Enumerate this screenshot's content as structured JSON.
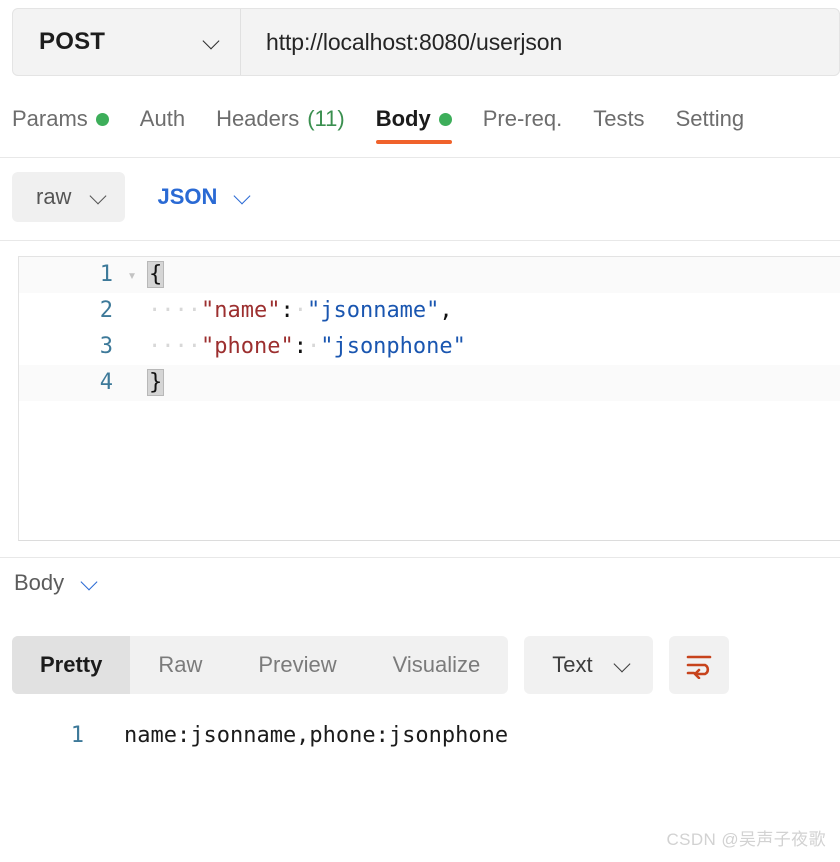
{
  "request": {
    "method": "POST",
    "url": "http://localhost:8080/userjson",
    "tabs": [
      {
        "label": "Params",
        "dot": true,
        "count": "",
        "active": false
      },
      {
        "label": "Auth",
        "dot": false,
        "count": "",
        "active": false
      },
      {
        "label": "Headers",
        "dot": false,
        "count": "(11)",
        "active": false
      },
      {
        "label": "Body",
        "dot": true,
        "count": "",
        "active": true
      },
      {
        "label": "Pre-req.",
        "dot": false,
        "count": "",
        "active": false
      },
      {
        "label": "Tests",
        "dot": false,
        "count": "",
        "active": false
      },
      {
        "label": "Setting",
        "dot": false,
        "count": "",
        "active": false
      }
    ],
    "body_mode": "raw",
    "body_format": "JSON",
    "editor": {
      "lines": [
        {
          "num": "1",
          "fold": true
        },
        {
          "num": "2",
          "fold": false
        },
        {
          "num": "3",
          "fold": false
        },
        {
          "num": "4",
          "fold": false
        }
      ],
      "line1_brace": "{",
      "line2_indent": "····",
      "line2_key": "\"name\"",
      "line2_colon": ":",
      "line2_space": "·",
      "line2_value": "\"jsonname\"",
      "line2_comma": ",",
      "line3_indent": "····",
      "line3_key": "\"phone\"",
      "line3_colon": ":",
      "line3_space": "·",
      "line3_value": "\"jsonphone\"",
      "line4_brace": "}"
    }
  },
  "response": {
    "section_label": "Body",
    "view_tabs": [
      {
        "label": "Pretty",
        "active": true
      },
      {
        "label": "Raw",
        "active": false
      },
      {
        "label": "Preview",
        "active": false
      },
      {
        "label": "Visualize",
        "active": false
      }
    ],
    "format": "Text",
    "wrap_icon": "word-wrap-icon",
    "lines": [
      {
        "num": "1",
        "text": "name:jsonname,phone:jsonphone"
      }
    ]
  },
  "watermark": "CSDN @吴声子夜歌",
  "colors": {
    "accent_orange": "#f0622b",
    "green_dot": "#3dae5a",
    "link_blue": "#2a6ad4",
    "gutter_blue": "#3d7999",
    "json_key": "#9c2f2f",
    "json_string": "#1a56b0"
  }
}
